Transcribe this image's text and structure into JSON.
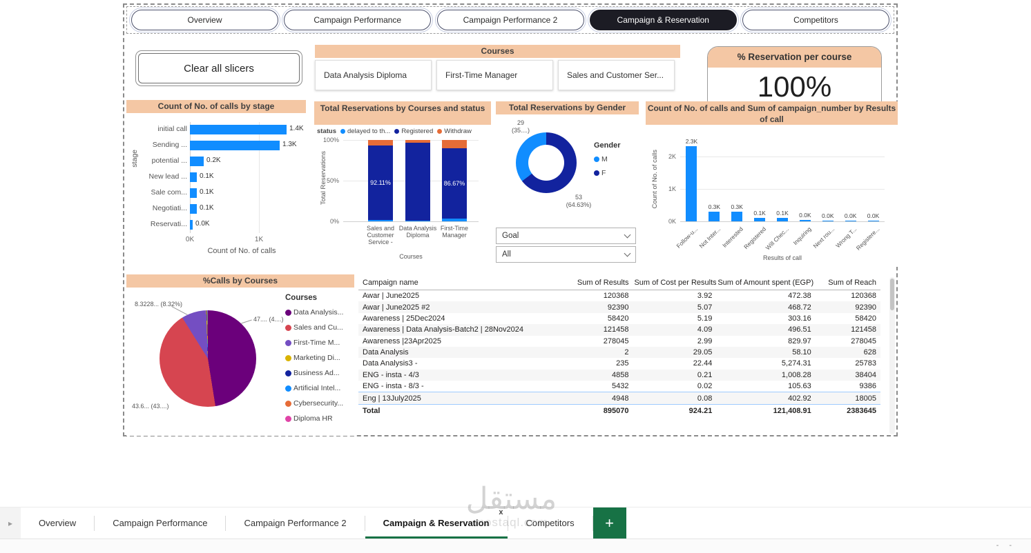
{
  "colors": {
    "header_salmon": "#F4C7A4",
    "bar_blue": "#118DFF",
    "navy": "#12239E",
    "orange": "#E66C37",
    "accent_green": "#177245",
    "active_nav": "#1c1c24"
  },
  "nav": {
    "buttons": [
      {
        "label": "Overview",
        "active": false
      },
      {
        "label": "Campaign Performance",
        "active": false
      },
      {
        "label": "Campaign Performance 2",
        "active": false
      },
      {
        "label": "Campaign & Reservation",
        "active": true
      },
      {
        "label": "Competitors",
        "active": false
      }
    ]
  },
  "slicers": {
    "clear_button_label": "Clear all slicers",
    "courses": {
      "title": "Courses",
      "items": [
        "Data Analysis Diploma",
        "First-Time Manager",
        "Sales and Customer Ser..."
      ]
    },
    "goal": {
      "label": "Goal",
      "value": "All"
    }
  },
  "kpi": {
    "title": "% Reservation per course",
    "value": "100%"
  },
  "chart_data": [
    {
      "type": "bar",
      "orientation": "horizontal",
      "title": "Count of No. of calls by stage",
      "categories": [
        "initial call",
        "Sending ...",
        "potential ...",
        "New lead ...",
        "Sale com...",
        "Negotiati...",
        "Reservati..."
      ],
      "values": [
        1400,
        1300,
        200,
        100,
        100,
        100,
        40
      ],
      "value_labels": [
        "1.4K",
        "1.3K",
        "0.2K",
        "0.1K",
        "0.1K",
        "0.1K",
        "0.0K"
      ],
      "xmax": 1500,
      "xticks": [
        {
          "label": "0K",
          "v": 0
        },
        {
          "label": "1K",
          "v": 1000
        }
      ],
      "xlabel": "Count of No. of calls",
      "ylabel": "stage",
      "bar_color": "#118DFF"
    },
    {
      "type": "bar",
      "stacked": true,
      "title": "Total Reservations by Courses and status",
      "legend_title": "status",
      "series": [
        {
          "name": "delayed to th...",
          "color": "#118DFF",
          "values": [
            1.5,
            0.5,
            3.0
          ]
        },
        {
          "name": "Registered",
          "color": "#12239E",
          "values": [
            92.11,
            96.5,
            86.67
          ]
        },
        {
          "name": "Withdraw",
          "color": "#E66C37",
          "values": [
            6.39,
            3.0,
            10.33
          ]
        }
      ],
      "data_labels": [
        "92.11%",
        "",
        "86.67%"
      ],
      "categories": [
        "Sales and Customer Service -",
        "Data Analysis Diploma",
        "First-Time Manager"
      ],
      "yticks": [
        "100%",
        "50%",
        "0%"
      ],
      "ylabel": "Total Reservations",
      "xlabel": "Courses"
    },
    {
      "type": "pie",
      "subtype": "donut",
      "title": "Total Reservations by Gender",
      "legend_title": "Gender",
      "legend": [
        {
          "name": "M",
          "color": "#118DFF"
        },
        {
          "name": "F",
          "color": "#12239E"
        }
      ],
      "slices": [
        {
          "name": "F",
          "value": 53,
          "pct": 64.63,
          "color": "#12239E",
          "label_lines": [
            "53",
            "(64.63%)"
          ]
        },
        {
          "name": "M",
          "value": 29,
          "pct": 35.37,
          "color": "#118DFF",
          "label_lines": [
            "29",
            "(35....)"
          ]
        }
      ]
    },
    {
      "type": "bar",
      "orientation": "vertical",
      "title": "Count of No. of calls and Sum of campaign_number by Results of call",
      "categories": [
        "Follow-u...",
        "Not Inter...",
        "Interested",
        "Registered",
        "Will Chec...",
        "Inquiring",
        "Next rou...",
        "Wrong T...",
        "Registere..."
      ],
      "values": [
        2300,
        300,
        300,
        100,
        100,
        40,
        30,
        25,
        20
      ],
      "value_labels": [
        "2.3K",
        "0.3K",
        "0.3K",
        "0.1K",
        "0.1K",
        "0.0K",
        "0.0K",
        "0.0K",
        "0.0K"
      ],
      "ymax": 2500,
      "yticks": [
        {
          "label": "0K",
          "v": 0
        },
        {
          "label": "1K",
          "v": 1000
        },
        {
          "label": "2K",
          "v": 2000
        }
      ],
      "ylabel": "Count of No. of calls",
      "xlabel": "Results of call",
      "bar_color": "#118DFF"
    },
    {
      "type": "pie",
      "title": "%Calls by Courses",
      "legend_title": "Courses",
      "slices": [
        {
          "name": "Data Analysis...",
          "pct": 47.49,
          "color": "#6B007B"
        },
        {
          "name": "Sales and Cu...",
          "pct": 43.63,
          "color": "#D64550"
        },
        {
          "name": "First-Time M...",
          "pct": 8.32,
          "color": "#744EC2"
        },
        {
          "name": "Marketing Di...",
          "pct": 0.2,
          "color": "#D9B300"
        },
        {
          "name": "Business Ad...",
          "pct": 0.12,
          "color": "#12239E"
        },
        {
          "name": "Artificial Intel...",
          "pct": 0.1,
          "color": "#118DFF"
        },
        {
          "name": "Cybersecurity...",
          "pct": 0.08,
          "color": "#E66C37"
        },
        {
          "name": "Diploma HR",
          "pct": 0.06,
          "color": "#E044A7"
        }
      ],
      "callouts": [
        {
          "text": "8.3228... (8.32%)",
          "pos": "top-left"
        },
        {
          "text": "47.... (4....)",
          "pos": "right"
        },
        {
          "text": "43.6... (43....)",
          "pos": "bottom-left"
        }
      ]
    }
  ],
  "table": {
    "columns": [
      "Campaign name",
      "Sum of Results",
      "Sum of Cost per Results",
      "Sum of Amount spent (EGP)",
      "Sum of Reach"
    ],
    "rows": [
      [
        "Awar | June2025",
        "120368",
        "3.92",
        "472.38",
        "120368"
      ],
      [
        "Awar | June2025 #2",
        "92390",
        "5.07",
        "468.72",
        "92390"
      ],
      [
        "Awareness | 25Dec2024",
        "58420",
        "5.19",
        "303.16",
        "58420"
      ],
      [
        "Awareness | Data Analysis-Batch2 | 28Nov2024",
        "121458",
        "4.09",
        "496.51",
        "121458"
      ],
      [
        "Awareness |23Apr2025",
        "278045",
        "2.99",
        "829.97",
        "278045"
      ],
      [
        "Data Analysis",
        "2",
        "29.05",
        "58.10",
        "628"
      ],
      [
        "Data Analysis3 -",
        "235",
        "22.44",
        "5,274.31",
        "25783"
      ],
      [
        "ENG - insta - 4/3",
        "4858",
        "0.21",
        "1,008.28",
        "38404"
      ],
      [
        "ENG - insta - 8/3 -",
        "5432",
        "0.02",
        "105.63",
        "9386"
      ],
      [
        "Eng | 13July2025",
        "4948",
        "0.08",
        "402.92",
        "18005"
      ]
    ],
    "selected_row_index": 9,
    "total": [
      "Total",
      "895070",
      "924.21",
      "121,408.91",
      "2383645"
    ]
  },
  "bottom_tabs": {
    "tabs": [
      {
        "label": "Overview",
        "active": false
      },
      {
        "label": "Campaign Performance",
        "active": false
      },
      {
        "label": "Campaign Performance 2",
        "active": false
      },
      {
        "label": "Campaign & Reservation",
        "active": true,
        "close_label": "x"
      },
      {
        "label": "Competitors",
        "active": false
      }
    ],
    "add_label": "+"
  },
  "watermark": {
    "arabic": "مستقل",
    "latin": "mostaql.com"
  },
  "footer": {
    "dashes": "- -"
  }
}
